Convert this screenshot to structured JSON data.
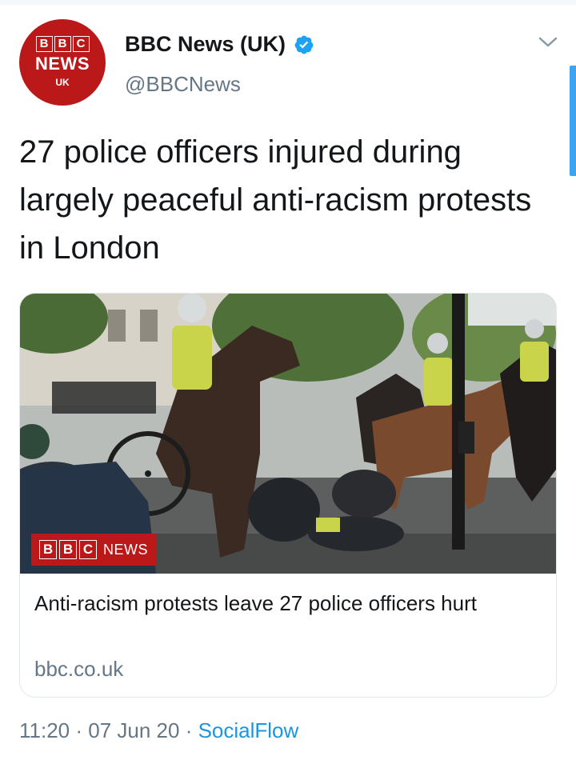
{
  "account": {
    "avatar": {
      "blocks": [
        "B",
        "B",
        "C"
      ],
      "word": "NEWS",
      "region": "UK",
      "color": "#bb1919"
    },
    "display_name": "BBC News (UK)",
    "verified_icon": "verified-badge-icon",
    "handle": "@BBCNews"
  },
  "menu_icon": "chevron-down-icon",
  "tweet": {
    "text": "27 police officers injured during largely peaceful anti-racism protests in London"
  },
  "card": {
    "image_alt": "Mounted police horse collides with traffic light pole during protests, officer falls",
    "watermark": {
      "blocks": [
        "B",
        "B",
        "C"
      ],
      "word": "NEWS"
    },
    "title": "Anti-racism protests leave 27 police officers hurt",
    "domain": "bbc.co.uk"
  },
  "meta": {
    "time": "11:20",
    "sep1": " · ",
    "date": "07 Jun 20",
    "sep2": " · ",
    "source": "SocialFlow"
  },
  "colors": {
    "accent": "#1b95e0",
    "muted": "#657786",
    "text": "#14171a",
    "border": "#e1e8ed"
  }
}
